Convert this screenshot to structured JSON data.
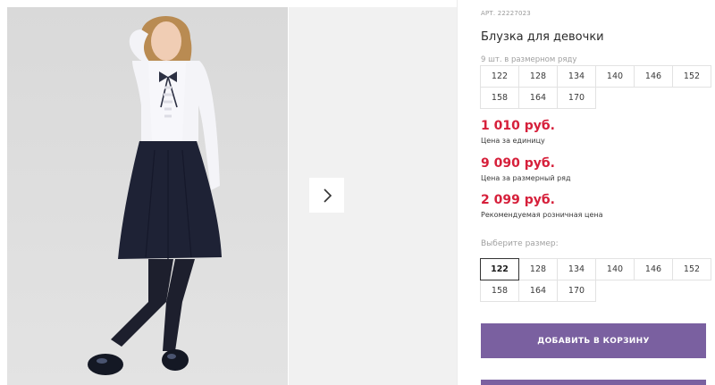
{
  "gallery": {
    "next_icon": "chevron-right-icon",
    "colors": {
      "main_bg": "#dcdcdc",
      "next_bg": "#f1f1f1"
    }
  },
  "product": {
    "sku": "АРТ. 22227023",
    "title": "Блузка для девочки",
    "size_row_caption": "9 шт. в размерном ряду",
    "size_row": [
      "122",
      "128",
      "134",
      "140",
      "146",
      "152",
      "158",
      "164",
      "170"
    ],
    "prices": [
      {
        "value": "1 010 руб.",
        "caption": "Цена за единицу"
      },
      {
        "value": "9 090 руб.",
        "caption": "Цена за размерный ряд"
      },
      {
        "value": "2 099 руб.",
        "caption": "Рекомендуемая розничная цена"
      }
    ],
    "choose_label": "Выберите размер:",
    "choose_sizes": [
      "122",
      "128",
      "134",
      "140",
      "146",
      "152",
      "158",
      "164",
      "170"
    ],
    "selected_size": "122",
    "add_to_cart": "ДОБАВИТЬ В КОРЗИНУ"
  },
  "colors": {
    "accent": "#7a60a0",
    "price": "#d6203b"
  }
}
